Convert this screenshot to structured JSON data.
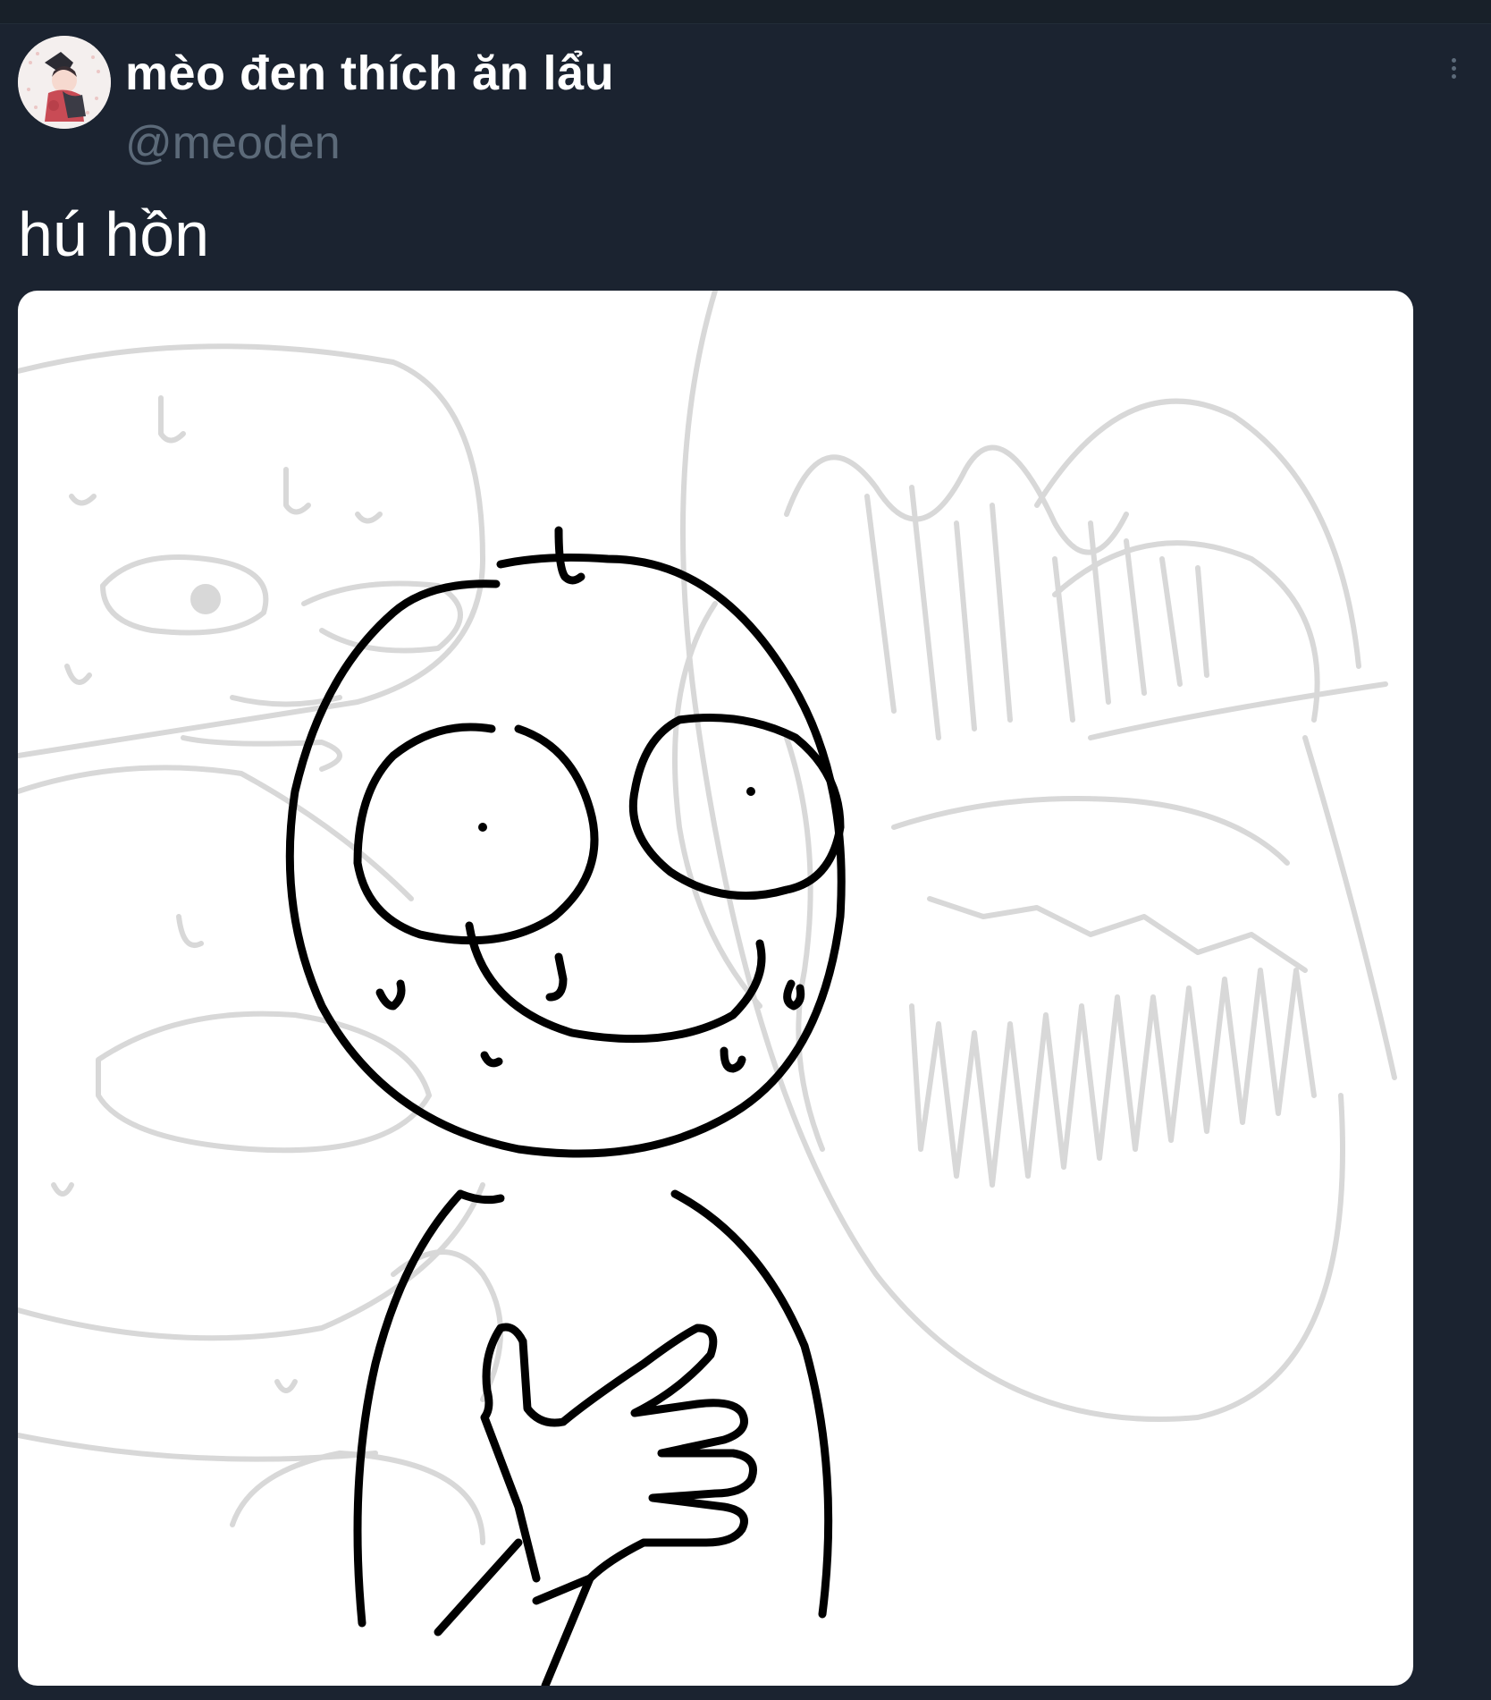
{
  "tweet": {
    "display_name": "mèo đen thích ăn lẩu",
    "handle": "@meoden",
    "text": "hú hồn"
  },
  "icons": {
    "more": "more-vertical-icon"
  },
  "colors": {
    "background": "#1b2330",
    "handle_text": "#5c6a79",
    "media_background": "#ffffff"
  }
}
